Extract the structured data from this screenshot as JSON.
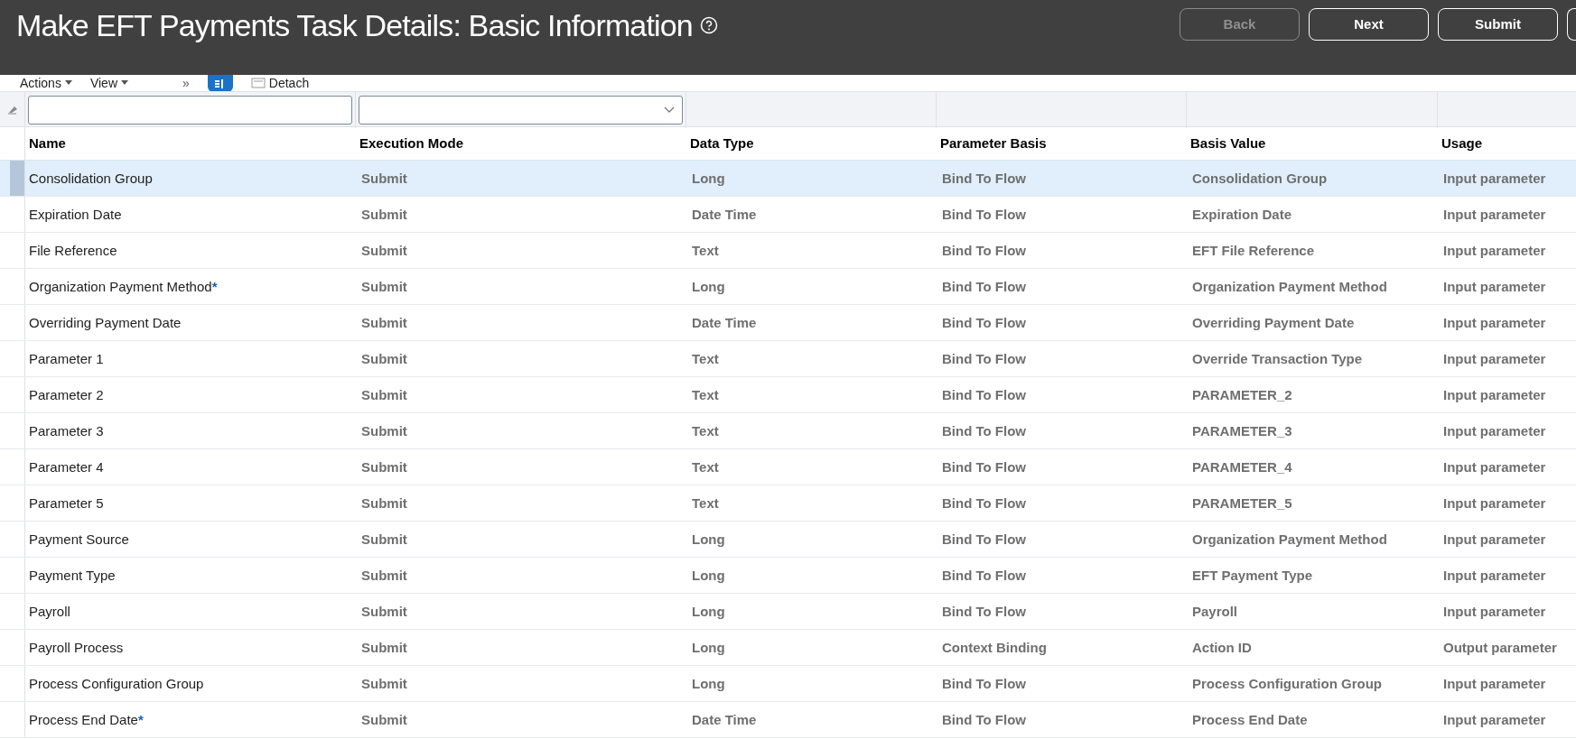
{
  "header": {
    "title": "Make EFT Payments Task Details: Basic Information",
    "buttons": [
      {
        "label": "Back",
        "disabled": true
      },
      {
        "label": "Next",
        "disabled": false
      },
      {
        "label": "Submit",
        "disabled": false
      }
    ]
  },
  "toolbar": {
    "items": [
      {
        "kind": "menu",
        "label": "Actions"
      },
      {
        "kind": "menu",
        "label": "View"
      },
      {
        "kind": "overflow",
        "label": "»"
      },
      {
        "kind": "toggle"
      },
      {
        "kind": "button",
        "label": "Detach"
      }
    ]
  },
  "table": {
    "columns": [
      "Name",
      "Execution Mode",
      "Data Type",
      "Parameter Basis",
      "Basis Value",
      "Usage"
    ],
    "filters": [
      {
        "kind": "text"
      },
      {
        "kind": "select"
      },
      {
        "kind": "none"
      },
      {
        "kind": "none"
      },
      {
        "kind": "none"
      },
      {
        "kind": "none"
      }
    ],
    "rows": [
      {
        "selected": true,
        "cells": [
          "Consolidation Group",
          "Submit",
          "Long",
          "Bind To Flow",
          "Consolidation Group",
          "Input parameter"
        ]
      },
      {
        "selected": false,
        "cells": [
          "Expiration Date",
          "Submit",
          "Date Time",
          "Bind To Flow",
          "Expiration Date",
          "Input parameter"
        ]
      },
      {
        "selected": false,
        "cells": [
          "File Reference",
          "Submit",
          "Text",
          "Bind To Flow",
          "EFT File Reference",
          "Input parameter"
        ]
      },
      {
        "selected": false,
        "required_mark": "*",
        "cells": [
          "Organization Payment Method",
          "Submit",
          "Long",
          "Bind To Flow",
          "Organization Payment Method",
          "Input parameter"
        ]
      },
      {
        "selected": false,
        "cells": [
          "Overriding Payment Date",
          "Submit",
          "Date Time",
          "Bind To Flow",
          "Overriding Payment Date",
          "Input parameter"
        ]
      },
      {
        "selected": false,
        "cells": [
          "Parameter 1",
          "Submit",
          "Text",
          "Bind To Flow",
          "Override Transaction Type",
          "Input parameter"
        ]
      },
      {
        "selected": false,
        "cells": [
          "Parameter 2",
          "Submit",
          "Text",
          "Bind To Flow",
          "PARAMETER_2",
          "Input parameter"
        ]
      },
      {
        "selected": false,
        "cells": [
          "Parameter 3",
          "Submit",
          "Text",
          "Bind To Flow",
          "PARAMETER_3",
          "Input parameter"
        ]
      },
      {
        "selected": false,
        "cells": [
          "Parameter 4",
          "Submit",
          "Text",
          "Bind To Flow",
          "PARAMETER_4",
          "Input parameter"
        ]
      },
      {
        "selected": false,
        "cells": [
          "Parameter 5",
          "Submit",
          "Text",
          "Bind To Flow",
          "PARAMETER_5",
          "Input parameter"
        ]
      },
      {
        "selected": false,
        "cells": [
          "Payment Source",
          "Submit",
          "Long",
          "Bind To Flow",
          "Organization Payment Method",
          "Input parameter"
        ]
      },
      {
        "selected": false,
        "cells": [
          "Payment Type",
          "Submit",
          "Long",
          "Bind To Flow",
          "EFT Payment Type",
          "Input parameter"
        ]
      },
      {
        "selected": false,
        "cells": [
          "Payroll",
          "Submit",
          "Long",
          "Bind To Flow",
          "Payroll",
          "Input parameter"
        ]
      },
      {
        "selected": false,
        "cells": [
          "Payroll Process",
          "Submit",
          "Long",
          "Context Binding",
          "Action ID",
          "Output parameter"
        ]
      },
      {
        "selected": false,
        "cells": [
          "Process Configuration Group",
          "Submit",
          "Long",
          "Bind To Flow",
          "Process Configuration Group",
          "Input parameter"
        ]
      },
      {
        "selected": false,
        "required_mark": "*",
        "cells": [
          "Process End Date",
          "Submit",
          "Date Time",
          "Bind To Flow",
          "Process End Date",
          "Input parameter"
        ]
      }
    ]
  }
}
